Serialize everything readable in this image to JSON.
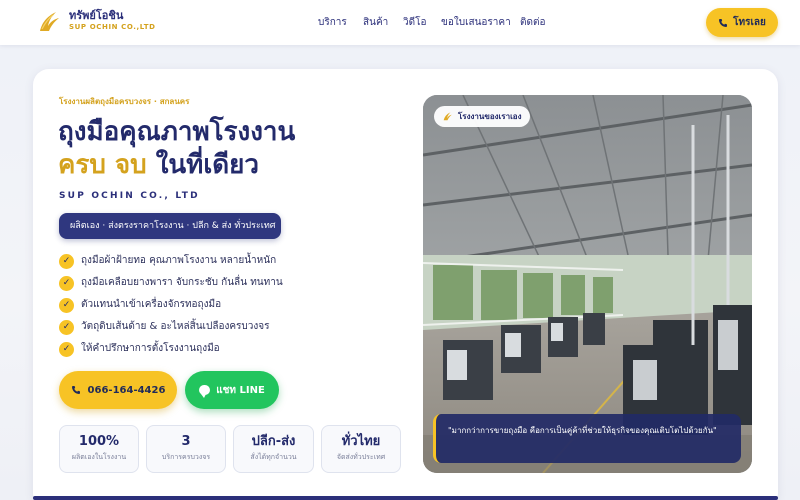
{
  "brand": {
    "name_th": "ทรัพย์โอชิน",
    "name_en": "SUP OCHIN CO.,LTD"
  },
  "nav": {
    "items": [
      "บริการ",
      "สินค้า",
      "วิดีโอ",
      "ขอใบเสนอราคา",
      "ติดต่อ"
    ]
  },
  "header": {
    "call_label": "โทรเลย"
  },
  "hero": {
    "eyebrow": "โรงงานผลิตถุงมือครบวงจร · สกลนคร",
    "title_line1": "ถุงมือคุณภาพโรงงาน",
    "title_line2_highlight": "ครบ จบ",
    "title_line2_rest": " ในที่เดียว",
    "company": "SUP OCHIN CO., LTD",
    "pill": "ผลิตเอง · ส่งตรงราคาโรงงาน · ปลีก & ส่ง ทั่วประเทศ",
    "features": [
      "ถุงมือผ้าฝ้ายทอ คุณภาพโรงงาน หลายน้ำหนัก",
      "ถุงมือเคลือบยางพารา จับกระชับ กันลื่น ทนทาน",
      "ตัวแทนนำเข้าเครื่องจักรทอถุงมือ",
      "วัตถุดิบเส้นด้าย & อะไหล่สิ้นเปลืองครบวงจร",
      "ให้คำปรึกษาการตั้งโรงงานถุงมือ"
    ],
    "check_mark": "✓",
    "cta_phone": "066-164-4426",
    "cta_line": "แชท LINE",
    "stats": [
      {
        "value": "100%",
        "label": "ผลิตเองในโรงงาน"
      },
      {
        "value": "3",
        "label": "บริการครบวงจร"
      },
      {
        "value": "ปลีก-ส่ง",
        "label": "สั่งได้ทุกจำนวน"
      },
      {
        "value": "ทั่วไทย",
        "label": "จัดส่งทั่วประเทศ"
      }
    ]
  },
  "photo": {
    "badge": "โรงงานของเราเอง",
    "quote": "\"มากกว่าการขายถุงมือ คือการเป็นคู่ค้าที่ช่วยให้ธุรกิจของคุณเติบโตไปด้วยกัน\""
  },
  "colors": {
    "navy": "#232a6b",
    "gold": "#d4a21e",
    "yellow": "#f7c325",
    "line_green": "#22c55e"
  },
  "icons": {
    "logo": "golden-wing-logo",
    "phone": "phone-icon",
    "line": "line-chat-icon",
    "check": "check-icon"
  }
}
